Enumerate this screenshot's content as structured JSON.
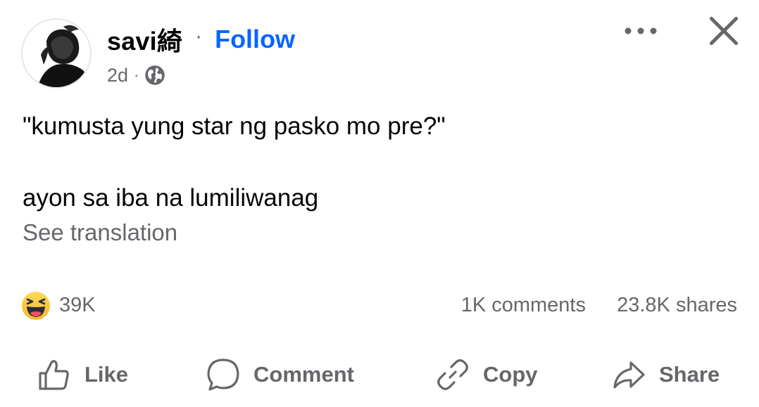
{
  "post": {
    "author": "savi綺",
    "separator": "·",
    "follow_label": "Follow",
    "time": "2d",
    "meta_separator": "·",
    "privacy_icon": "globe-icon",
    "line1": "\"kumusta yung star ng pasko mo pre?\"",
    "line2": "ayon sa iba na lumiliwanag",
    "see_translation": "See translation"
  },
  "stats": {
    "reaction_icon": "haha-emoji-icon",
    "reactions": "39K",
    "comments": "1K comments",
    "shares": "23.8K shares"
  },
  "actions": {
    "like": "Like",
    "comment": "Comment",
    "copy": "Copy",
    "share": "Share"
  },
  "colors": {
    "accent": "#0866ff",
    "secondary_text": "#65676b",
    "primary_text": "#050505"
  }
}
